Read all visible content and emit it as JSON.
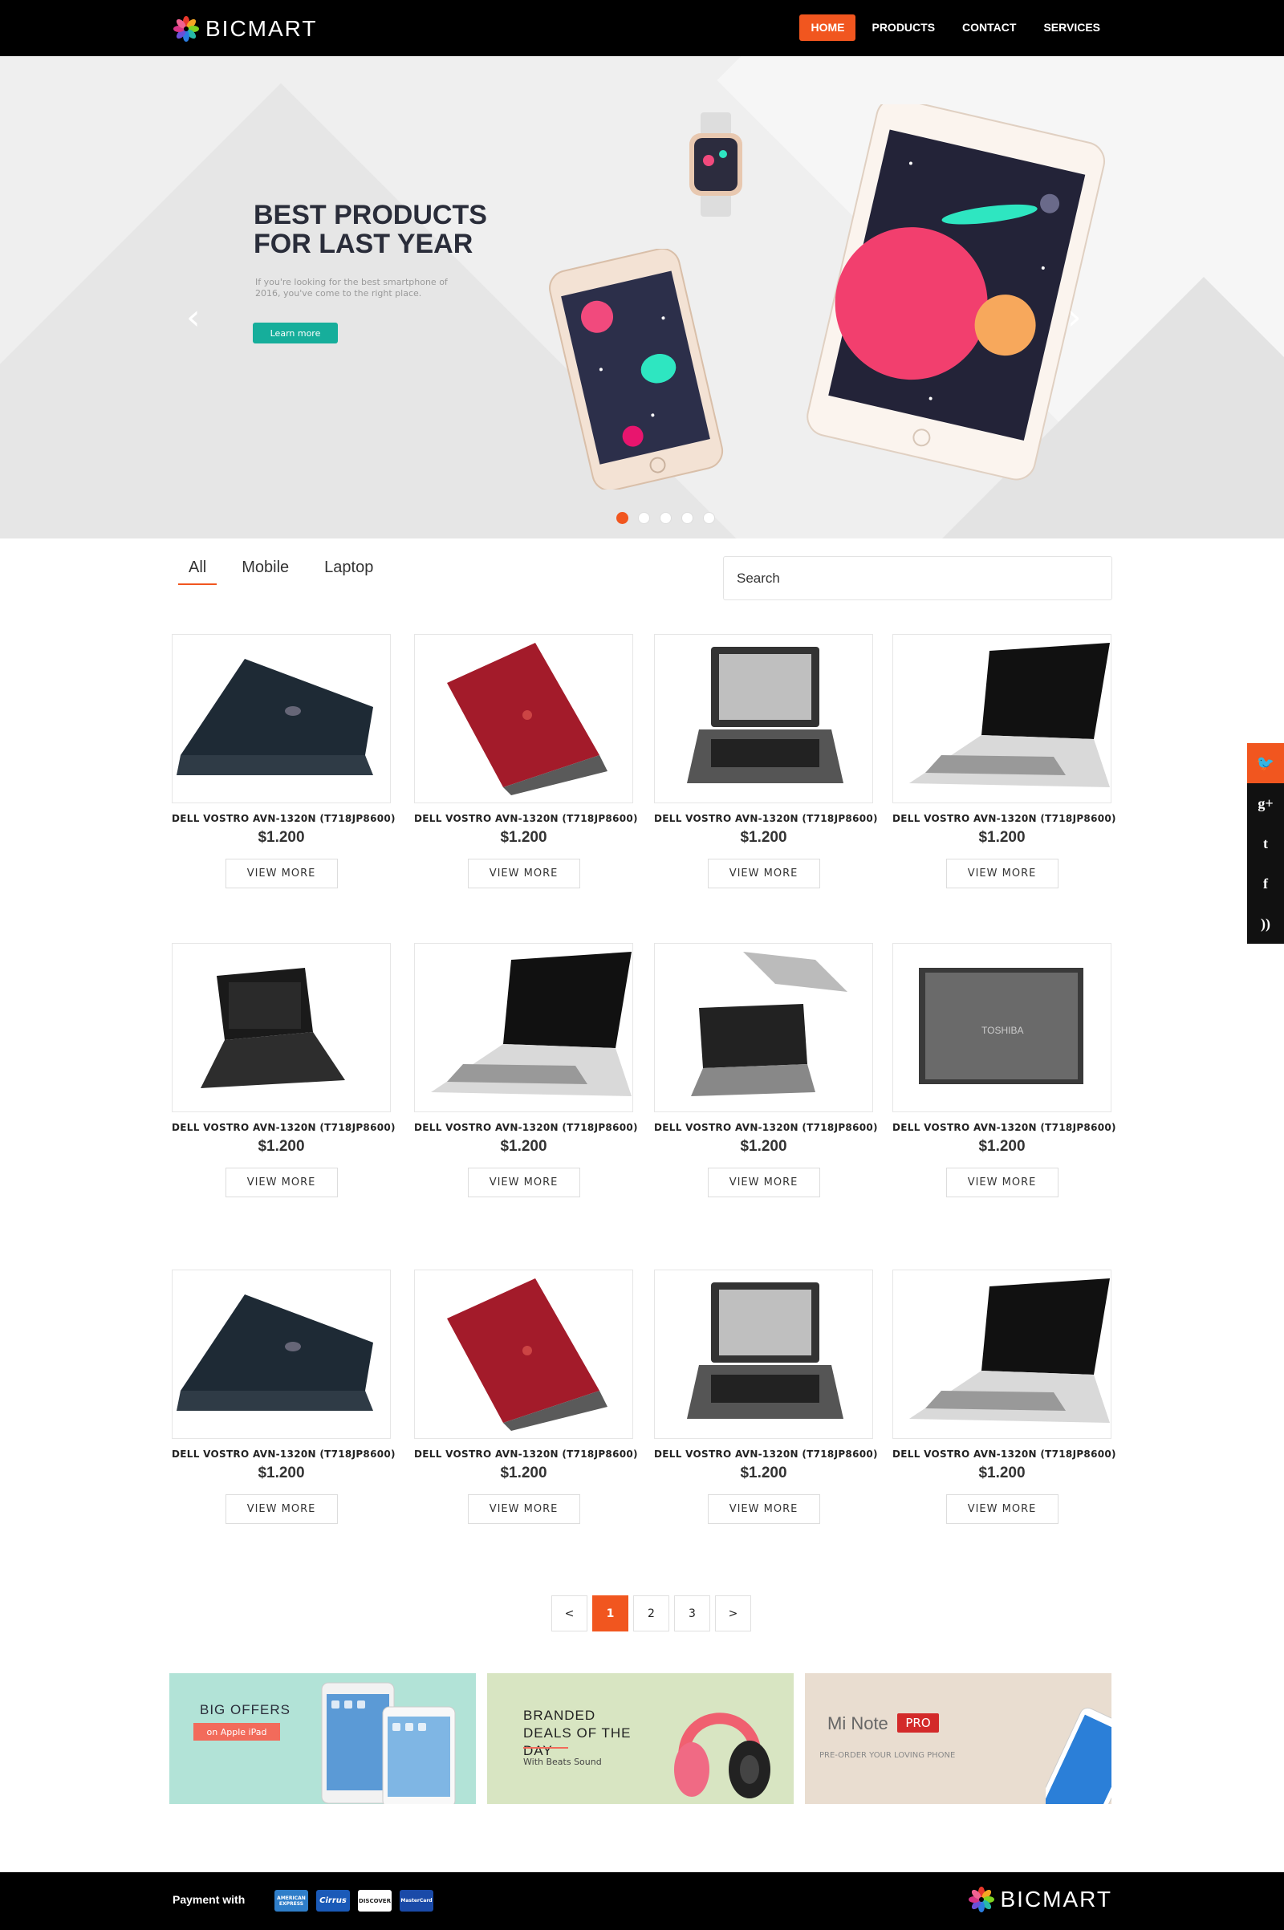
{
  "header": {
    "brand": "BICMART",
    "nav": [
      "HOME",
      "PRODUCTS",
      "CONTACT",
      "SERVICES"
    ],
    "active_nav": "HOME",
    "accent_color": "#f1561f"
  },
  "hero": {
    "title": "BEST PRODUCTS FOR LAST YEAR",
    "subtitle": "If you're looking for the best smartphone of 2016, you've come to the right place.",
    "button": "Learn more",
    "prev_icon": "chevron-left-icon",
    "next_icon": "chevron-right-icon",
    "slide_count": 5,
    "active_slide": 1
  },
  "filters": {
    "tabs": [
      "All",
      "Mobile",
      "Laptop"
    ],
    "active_tab": "All",
    "search_placeholder": "Search"
  },
  "products": [
    {
      "name": "DELL VOSTRO AVN-1320N (T718JP8600)",
      "price": "$1.200",
      "button": "VIEW MORE",
      "image": "black-laptop-side"
    },
    {
      "name": "DELL VOSTRO AVN-1320N (T718JP8600)",
      "price": "$1.200",
      "button": "VIEW MORE",
      "image": "red-laptop"
    },
    {
      "name": "DELL VOSTRO AVN-1320N (T718JP8600)",
      "price": "$1.200",
      "button": "VIEW MORE",
      "image": "silver-laptop-front"
    },
    {
      "name": "DELL VOSTRO AVN-1320N (T718JP8600)",
      "price": "$1.200",
      "button": "VIEW MORE",
      "image": "white-laptop-open"
    },
    {
      "name": "DELL VOSTRO AVN-1320N (T718JP8600)",
      "price": "$1.200",
      "button": "VIEW MORE",
      "image": "small-black-laptop"
    },
    {
      "name": "DELL VOSTRO AVN-1320N (T718JP8600)",
      "price": "$1.200",
      "button": "VIEW MORE",
      "image": "white-laptop-open"
    },
    {
      "name": "DELL VOSTRO AVN-1320N (T718JP8600)",
      "price": "$1.200",
      "button": "VIEW MORE",
      "image": "toshiba-two-laptops"
    },
    {
      "name": "DELL VOSTRO AVN-1320N (T718JP8600)",
      "price": "$1.200",
      "button": "VIEW MORE",
      "image": "closed-laptop-lid"
    },
    {
      "name": "DELL VOSTRO AVN-1320N (T718JP8600)",
      "price": "$1.200",
      "button": "VIEW MORE",
      "image": "black-laptop-side"
    },
    {
      "name": "DELL VOSTRO AVN-1320N (T718JP8600)",
      "price": "$1.200",
      "button": "VIEW MORE",
      "image": "red-laptop"
    },
    {
      "name": "DELL VOSTRO AVN-1320N (T718JP8600)",
      "price": "$1.200",
      "button": "VIEW MORE",
      "image": "silver-laptop-front"
    },
    {
      "name": "DELL VOSTRO AVN-1320N (T718JP8600)",
      "price": "$1.200",
      "button": "VIEW MORE",
      "image": "white-laptop-open"
    }
  ],
  "pagination": {
    "items": [
      "<",
      "1",
      "2",
      "3",
      ">"
    ],
    "current": "1"
  },
  "banners": [
    {
      "title": "BIG OFFERS",
      "tag": "on Apple iPad"
    },
    {
      "title": "BRANDED DEALS OF THE DAY",
      "sub": "With Beats Sound"
    },
    {
      "title": "Mi Note",
      "badge": "PRO",
      "sub": "PRE-ORDER YOUR LOVING PHONE"
    }
  ],
  "social": [
    "twitter-icon",
    "google-plus-icon",
    "tumblr-icon",
    "facebook-icon",
    "rss-icon"
  ],
  "footer": {
    "payment_label": "Payment with",
    "cards": [
      "AMERICAN EXPRESS",
      "Cirrus",
      "DISCOVER",
      "MasterCard"
    ],
    "brand": "BICMART"
  }
}
